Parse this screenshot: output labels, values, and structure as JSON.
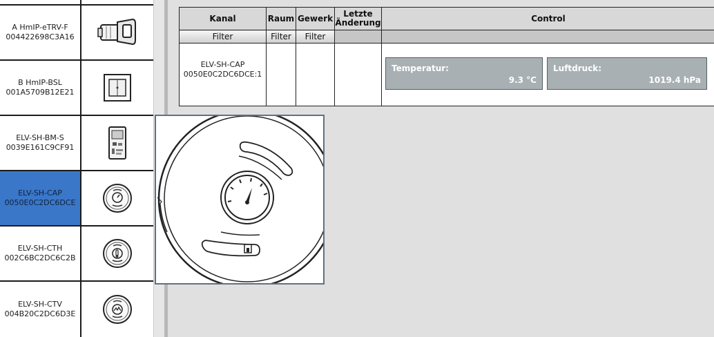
{
  "sidebar": {
    "devices": [
      {
        "type": "A HmIP-eTRV-F",
        "serial": "004422698C3A16",
        "icon": "thermostat-valve-icon",
        "selected": false
      },
      {
        "type": "B HmIP-BSL",
        "serial": "001A5709B12E21",
        "icon": "wall-switch-icon",
        "selected": false
      },
      {
        "type": "ELV-SH-BM-S",
        "serial": "0039E161C9CF91",
        "icon": "circuit-board-icon",
        "selected": false
      },
      {
        "type": "ELV-SH-CAP",
        "serial": "0050E0C2DC6DCE",
        "icon": "pressure-sensor-icon",
        "selected": true
      },
      {
        "type": "ELV-SH-CTH",
        "serial": "002C6BC2DC6C2B",
        "icon": "temp-humidity-sensor-icon",
        "selected": false
      },
      {
        "type": "ELV-SH-CTV",
        "serial": "004B20C2DC6D3E",
        "icon": "tilt-vibration-sensor-icon",
        "selected": false
      }
    ]
  },
  "table": {
    "headers": {
      "kanal": "Kanal",
      "raum": "Raum",
      "gewerk": "Gewerk",
      "letzte_line1": "Letzte",
      "letzte_line2": "Änderung",
      "control": "Control"
    },
    "filters": {
      "kanal": "Filter",
      "raum": "Filter",
      "gewerk": "Filter"
    },
    "row": {
      "channel_name": "ELV-SH-CAP",
      "channel_address": "0050E0C2DC6DCE:1",
      "raum": "",
      "gewerk": "",
      "letzte": "",
      "controls": [
        {
          "label": "Temperatur:",
          "value": "9.3 °C"
        },
        {
          "label": "Luftdruck:",
          "value": "1019.4 hPa"
        }
      ]
    }
  },
  "popup": {
    "image": "pressure-sensor-large-image"
  },
  "colors": {
    "selected": "#3a77c9",
    "control_box": "#a9b0b3",
    "background": "#e0e0e0",
    "popup_border": "#5d7183"
  }
}
